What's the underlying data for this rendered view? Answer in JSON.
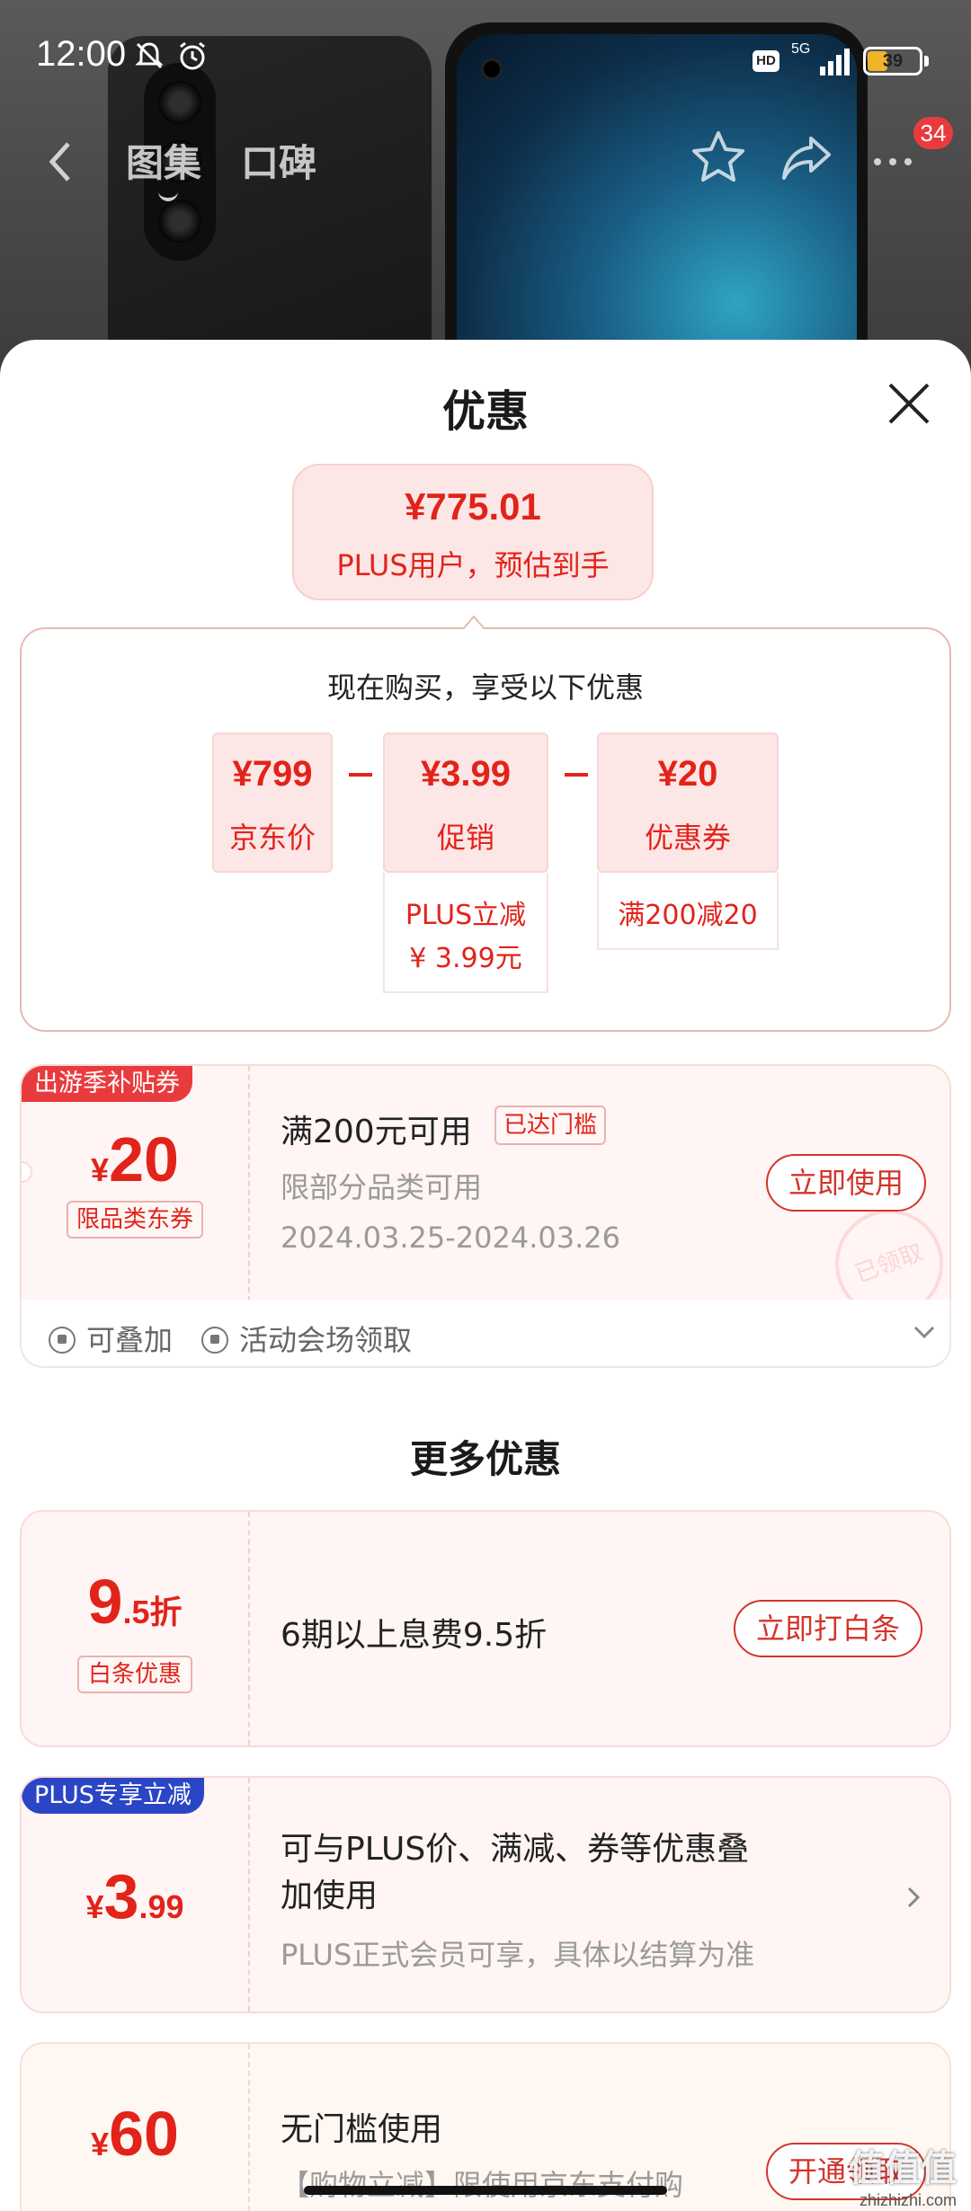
{
  "status_bar": {
    "time": "12:00",
    "network": "5G",
    "battery": "39",
    "battery_level": 0.39,
    "hd": "HD"
  },
  "nav": {
    "tab_gallery": "图集",
    "tab_reviews": "口碑",
    "badge_count": "34"
  },
  "sheet": {
    "title": "优惠"
  },
  "estimate": {
    "price": "¥775.01",
    "note": "PLUS用户，预估到手"
  },
  "breakdown": {
    "lead": "现在购买，享受以下优惠",
    "items": [
      {
        "value": "¥799",
        "label": "京东价"
      },
      {
        "value": "¥3.99",
        "label": "促销",
        "detail_line1": "PLUS立减",
        "detail_line2": "¥ 3.99元"
      },
      {
        "value": "¥20",
        "label": "优惠券",
        "detail_line1": "满200减20"
      }
    ]
  },
  "coupon1": {
    "tag": "出游季补贴券",
    "symbol": "¥",
    "amount": "20",
    "type": "限品类东券",
    "title": "满200元可用",
    "status": "已达门槛",
    "scope": "限部分品类可用",
    "validity": "2024.03.25-2024.03.26",
    "button": "立即使用",
    "stamp": "已领取",
    "footer_stack": "可叠加",
    "footer_source": "活动会场领取"
  },
  "more_title": "更多优惠",
  "baitiao": {
    "amount_int": "9",
    "amount_suffix": ".5折",
    "type": "白条优惠",
    "title": "6期以上息费9.5折",
    "button": "立即打白条"
  },
  "plus": {
    "tag": "PLUS专享立减",
    "symbol": "¥",
    "amount_int": "3",
    "amount_dec": ".99",
    "title_line1": "可与PLUS价、满减、券等优惠叠",
    "title_line2": "加使用",
    "desc": "PLUS正式会员可享，具体以结算为准"
  },
  "pay": {
    "symbol": "¥",
    "amount": "60",
    "title": "无门槛使用",
    "desc": "【购物立减】限使用京东支付购",
    "button": "开通领取"
  },
  "watermark": {
    "text": "值值值",
    "site": "zhizhizhi.com"
  }
}
